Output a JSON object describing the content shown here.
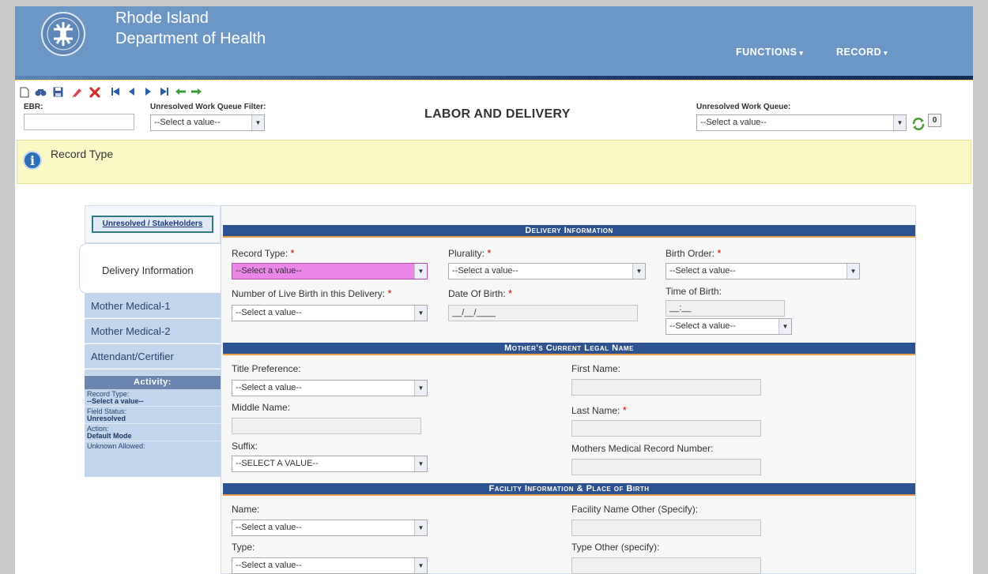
{
  "header": {
    "dept_line1": "Rhode Island",
    "dept_line2": "Department of Health",
    "nav": {
      "functions": "FUNCTIONS",
      "record": "RECORD",
      "caret": "▾"
    }
  },
  "toolbar": {
    "icons": [
      "new-icon",
      "find-icon",
      "save-icon",
      "edit-icon",
      "delete-icon",
      "first-record-icon",
      "previous-record-icon",
      "next-record-icon",
      "last-record-icon",
      "back-arrow-icon",
      "forward-arrow-icon"
    ],
    "ebr_label": "EBR:",
    "filter_label": "Unresolved Work Queue Filter:",
    "filter_value": "--Select a value--",
    "heading": "LABOR AND DELIVERY",
    "queue_label": "Unresolved Work Queue:",
    "queue_value": "--Select a value--",
    "queue_count": "0"
  },
  "infobar": {
    "text": "Record Type"
  },
  "side": {
    "unresolved_button": "Unresolved / StakeHolders",
    "active_item": "Delivery Information",
    "items": [
      "Mother Medical-1",
      "Mother Medical-2",
      "Attendant/Certifier"
    ],
    "activity_title": "Activity:",
    "activity": [
      {
        "label": "Record Type:",
        "value": "--Select a value--"
      },
      {
        "label": "Field Status:",
        "value": "Unresolved"
      },
      {
        "label": "Action:",
        "value": "Default Mode"
      },
      {
        "label": "Unknown Allowed:",
        "value": ""
      }
    ]
  },
  "form": {
    "sections": {
      "delivery": "Delivery Information",
      "mother_name": "Mother's Current Legal Name",
      "facility": "Facility Information & Place of Birth"
    },
    "required_mark": "*",
    "fields": {
      "record_type": {
        "label": "Record Type:",
        "value": "--Select a value--"
      },
      "plurality": {
        "label": "Plurality:",
        "value": "--Select a value--"
      },
      "birth_order": {
        "label": "Birth Order:",
        "value": "--Select a value--"
      },
      "live_births": {
        "label": "Number of Live Birth in this Delivery:",
        "value": "--Select a value--"
      },
      "date_of_birth": {
        "label": "Date Of Birth:",
        "value": "__/__/____"
      },
      "time_of_birth": {
        "label": "Time of Birth:",
        "value": "__:__",
        "ampm": "--Select a value--"
      },
      "title_pref": {
        "label": "Title Preference:",
        "value": "--Select a value--"
      },
      "first_name": {
        "label": "First Name:",
        "value": ""
      },
      "middle_name": {
        "label": "Middle Name:",
        "value": ""
      },
      "last_name": {
        "label": "Last Name:",
        "value": ""
      },
      "suffix": {
        "label": "Suffix:",
        "value": "--SELECT A VALUE--"
      },
      "mrn": {
        "label": "Mothers Medical Record Number:",
        "value": ""
      },
      "facility_name": {
        "label": "Name:",
        "value": "--Select a value--"
      },
      "facility_other": {
        "label": "Facility Name Other (Specify):",
        "value": ""
      },
      "facility_type": {
        "label": "Type:",
        "value": "--Select a value--"
      },
      "type_other": {
        "label": "Type Other (specify):",
        "value": ""
      }
    }
  },
  "colors": {
    "header": "#6c97c4",
    "section_head": "#2d5290",
    "section_underline": "#e8a04a",
    "highlight_field": "#e986e6",
    "side_menu": "#c1d6ec",
    "info_bar": "#fbf8c7"
  }
}
